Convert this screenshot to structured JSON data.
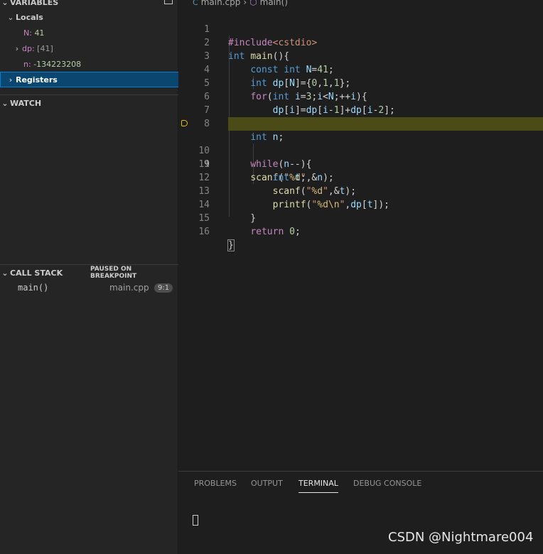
{
  "sidebar": {
    "variables_title": "VARIABLES",
    "locals_label": "Locals",
    "vars": [
      {
        "name": "N:",
        "value": "41"
      },
      {
        "name": "dp:",
        "value": "[41]"
      },
      {
        "name": "n:",
        "value": "-134223208"
      }
    ],
    "registers_label": "Registers",
    "watch_title": "WATCH",
    "callstack_title": "CALL STACK",
    "callstack_status": "PAUSED ON BREAKPOINT",
    "frame": {
      "function": "main()",
      "file": "main.cpp",
      "position": "9:1"
    }
  },
  "breadcrumb": {
    "file": "main.cpp",
    "symbol": "main()"
  },
  "editor": {
    "current_line": 9,
    "line_numbers": [
      "1",
      "2",
      "3",
      "4",
      "5",
      "6",
      "7",
      "8",
      "9",
      "10",
      "11",
      "12",
      "13",
      "14",
      "15",
      "16"
    ]
  },
  "panel": {
    "tabs": [
      "PROBLEMS",
      "OUTPUT",
      "TERMINAL",
      "DEBUG CONSOLE"
    ],
    "active_tab": "TERMINAL"
  },
  "watermark": "CSDN @Nightmare004",
  "colors": {
    "breakpoint": "#e5c000",
    "current_line_bg": "#4b4b18",
    "selection": "#094771"
  }
}
